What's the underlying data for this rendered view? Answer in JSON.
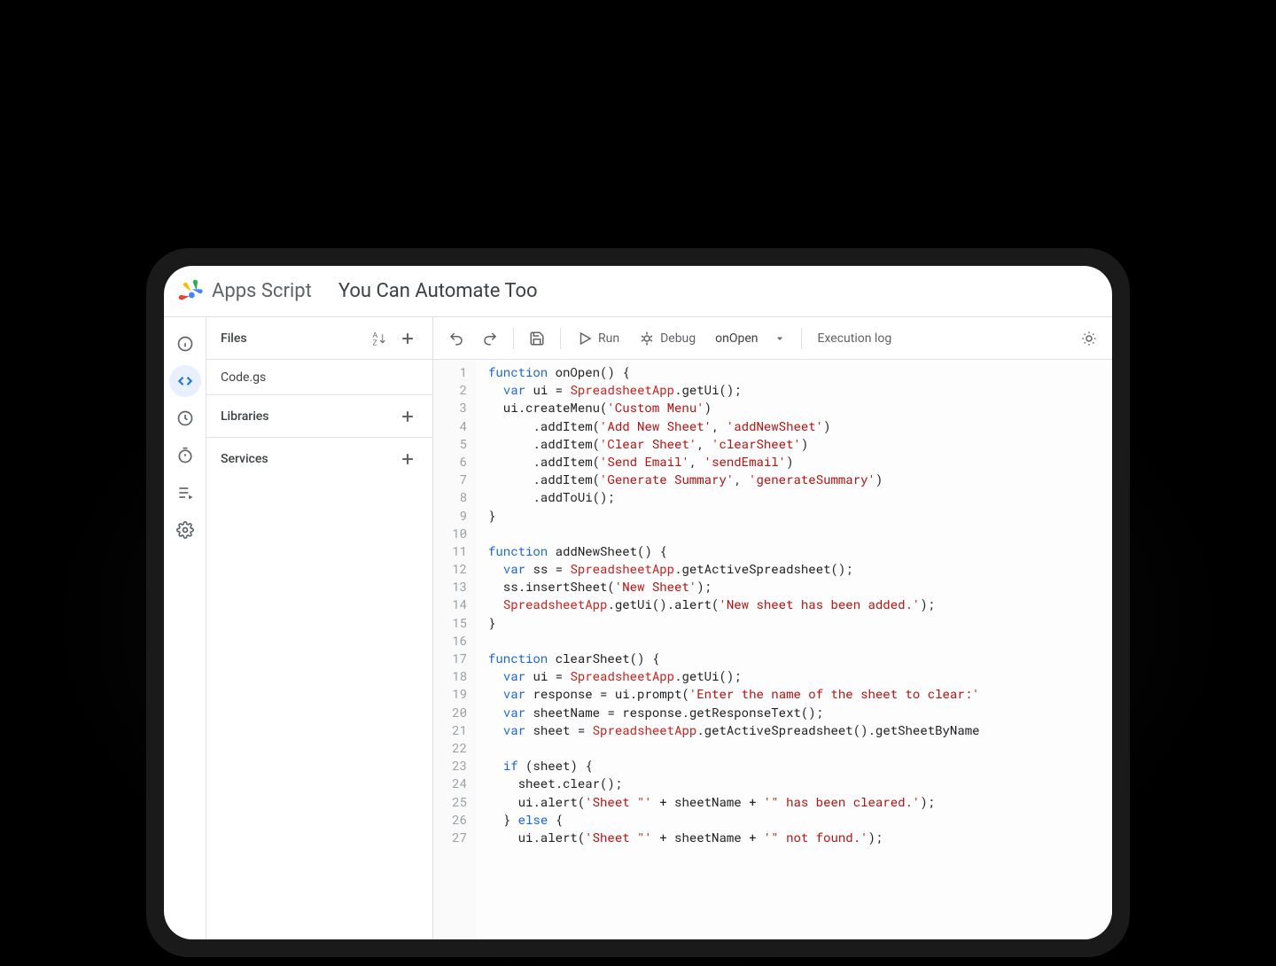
{
  "header": {
    "product": "Apps Script",
    "title": "You Can Automate Too"
  },
  "nav": {
    "items": [
      "overview",
      "editor",
      "triggers",
      "executions",
      "project-settings"
    ]
  },
  "sidebar": {
    "files_label": "Files",
    "files": [
      "Code.gs"
    ],
    "libraries_label": "Libraries",
    "services_label": "Services"
  },
  "toolbar": {
    "run": "Run",
    "debug": "Debug",
    "selected_function": "onOpen",
    "execution_log": "Execution log"
  },
  "code": {
    "lines": [
      {
        "n": 1,
        "tokens": [
          [
            "kw",
            "function"
          ],
          [
            "",
            null
          ],
          [
            "fn",
            "onOpen"
          ],
          [
            "punc",
            "()"
          ],
          [
            "",
            null
          ],
          [
            "punc",
            "{"
          ]
        ]
      },
      {
        "n": 2,
        "tokens": [
          [
            "",
            "  "
          ],
          [
            "kw",
            "var"
          ],
          [
            "",
            null
          ],
          [
            "",
            "ui = "
          ],
          [
            "cls",
            "SpreadsheetApp"
          ],
          [
            "",
            ".getUi();"
          ]
        ]
      },
      {
        "n": 3,
        "tokens": [
          [
            "",
            "  ui.createMenu("
          ],
          [
            "str",
            "'Custom Menu'"
          ],
          [
            "",
            ")"
          ]
        ]
      },
      {
        "n": 4,
        "tokens": [
          [
            "",
            "      .addItem("
          ],
          [
            "str",
            "'Add New Sheet'"
          ],
          [
            "",
            ", "
          ],
          [
            "str",
            "'addNewSheet'"
          ],
          [
            "",
            ")"
          ]
        ]
      },
      {
        "n": 5,
        "tokens": [
          [
            "",
            "      .addItem("
          ],
          [
            "str",
            "'Clear Sheet'"
          ],
          [
            "",
            ", "
          ],
          [
            "str",
            "'clearSheet'"
          ],
          [
            "",
            ")"
          ]
        ]
      },
      {
        "n": 6,
        "tokens": [
          [
            "",
            "      .addItem("
          ],
          [
            "str",
            "'Send Email'"
          ],
          [
            "",
            ", "
          ],
          [
            "str",
            "'sendEmail'"
          ],
          [
            "",
            ")"
          ]
        ]
      },
      {
        "n": 7,
        "tokens": [
          [
            "",
            "      .addItem("
          ],
          [
            "str",
            "'Generate Summary'"
          ],
          [
            "",
            ", "
          ],
          [
            "str",
            "'generateSummary'"
          ],
          [
            "",
            ")"
          ]
        ]
      },
      {
        "n": 8,
        "tokens": [
          [
            "",
            "      .addToUi();"
          ]
        ]
      },
      {
        "n": 9,
        "tokens": [
          [
            "punc",
            "}"
          ]
        ]
      },
      {
        "n": 10,
        "tokens": [
          [
            "",
            ""
          ]
        ]
      },
      {
        "n": 11,
        "tokens": [
          [
            "kw",
            "function"
          ],
          [
            "",
            null
          ],
          [
            "fn",
            "addNewSheet"
          ],
          [
            "punc",
            "()"
          ],
          [
            "",
            null
          ],
          [
            "punc",
            "{"
          ]
        ]
      },
      {
        "n": 12,
        "tokens": [
          [
            "",
            "  "
          ],
          [
            "kw",
            "var"
          ],
          [
            "",
            null
          ],
          [
            "",
            "ss = "
          ],
          [
            "cls",
            "SpreadsheetApp"
          ],
          [
            "",
            ".getActiveSpreadsheet();"
          ]
        ]
      },
      {
        "n": 13,
        "tokens": [
          [
            "",
            "  ss.insertSheet("
          ],
          [
            "str",
            "'New Sheet'"
          ],
          [
            "",
            ");"
          ]
        ]
      },
      {
        "n": 14,
        "tokens": [
          [
            "",
            "  "
          ],
          [
            "cls",
            "SpreadsheetApp"
          ],
          [
            "",
            ".getUi().alert("
          ],
          [
            "str",
            "'New sheet has been added.'"
          ],
          [
            "",
            ");"
          ]
        ]
      },
      {
        "n": 15,
        "tokens": [
          [
            "punc",
            "}"
          ]
        ]
      },
      {
        "n": 16,
        "tokens": [
          [
            "",
            ""
          ]
        ]
      },
      {
        "n": 17,
        "tokens": [
          [
            "kw",
            "function"
          ],
          [
            "",
            null
          ],
          [
            "fn",
            "clearSheet"
          ],
          [
            "punc",
            "()"
          ],
          [
            "",
            null
          ],
          [
            "punc",
            "{"
          ]
        ]
      },
      {
        "n": 18,
        "tokens": [
          [
            "",
            "  "
          ],
          [
            "kw",
            "var"
          ],
          [
            "",
            null
          ],
          [
            "",
            "ui = "
          ],
          [
            "cls",
            "SpreadsheetApp"
          ],
          [
            "",
            ".getUi();"
          ]
        ]
      },
      {
        "n": 19,
        "tokens": [
          [
            "",
            "  "
          ],
          [
            "kw",
            "var"
          ],
          [
            "",
            null
          ],
          [
            "",
            "response = ui.prompt("
          ],
          [
            "str",
            "'Enter the name of the sheet to clear:'"
          ]
        ]
      },
      {
        "n": 20,
        "tokens": [
          [
            "",
            "  "
          ],
          [
            "kw",
            "var"
          ],
          [
            "",
            null
          ],
          [
            "",
            "sheetName = response.getResponseText();"
          ]
        ]
      },
      {
        "n": 21,
        "tokens": [
          [
            "",
            "  "
          ],
          [
            "kw",
            "var"
          ],
          [
            "",
            null
          ],
          [
            "",
            "sheet = "
          ],
          [
            "cls",
            "SpreadsheetApp"
          ],
          [
            "",
            ".getActiveSpreadsheet().getSheetByName"
          ]
        ]
      },
      {
        "n": 22,
        "tokens": [
          [
            "",
            ""
          ]
        ]
      },
      {
        "n": 23,
        "tokens": [
          [
            "",
            "  "
          ],
          [
            "kw",
            "if"
          ],
          [
            "",
            null
          ],
          [
            "",
            "(sheet) {"
          ]
        ]
      },
      {
        "n": 24,
        "tokens": [
          [
            "",
            "    sheet.clear();"
          ]
        ]
      },
      {
        "n": 25,
        "tokens": [
          [
            "",
            "    ui.alert("
          ],
          [
            "str",
            "'Sheet \"'"
          ],
          [
            "",
            null
          ],
          [
            "",
            "+ sheetName +"
          ],
          [
            "",
            null
          ],
          [
            "str",
            "'\" has been cleared.'"
          ],
          [
            "",
            ");"
          ]
        ]
      },
      {
        "n": 26,
        "tokens": [
          [
            "",
            "  } "
          ],
          [
            "kw",
            "else"
          ],
          [
            "",
            null
          ],
          [
            "punc",
            "{"
          ]
        ]
      },
      {
        "n": 27,
        "tokens": [
          [
            "",
            "    ui.alert("
          ],
          [
            "str",
            "'Sheet \"'"
          ],
          [
            "",
            null
          ],
          [
            "",
            "+ sheetName +"
          ],
          [
            "",
            null
          ],
          [
            "str",
            "'\" not found.'"
          ],
          [
            "",
            ");"
          ]
        ]
      }
    ]
  }
}
